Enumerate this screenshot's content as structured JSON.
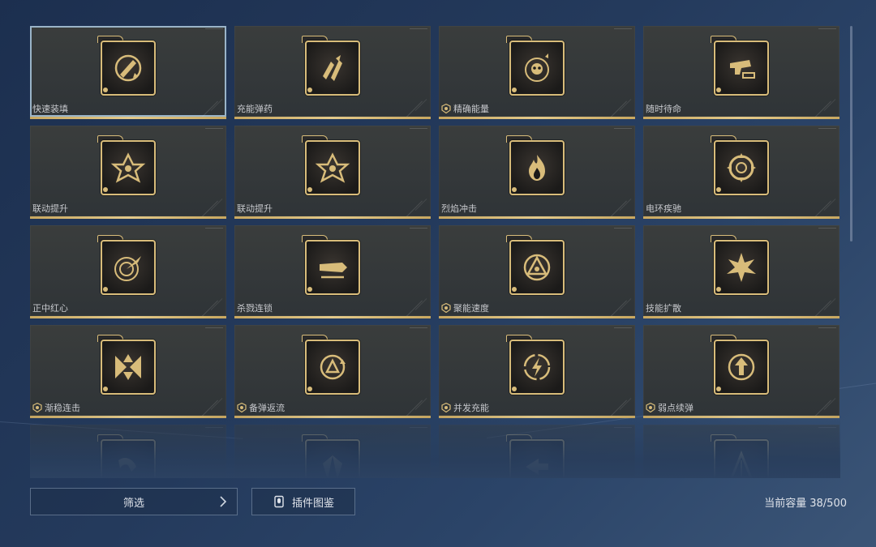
{
  "plugins": [
    {
      "name": "快速装填",
      "icon": "missile-reload-icon",
      "badge": false,
      "selected": true
    },
    {
      "name": "充能弹药",
      "icon": "bullets-icon",
      "badge": false
    },
    {
      "name": "精确能量",
      "icon": "skull-target-icon",
      "badge": true
    },
    {
      "name": "随时待命",
      "icon": "pistol-ammo-icon",
      "badge": false
    },
    {
      "name": "联动提升",
      "icon": "star-link-icon",
      "badge": false
    },
    {
      "name": "联动提升",
      "icon": "star-link-icon",
      "badge": false
    },
    {
      "name": "烈焰冲击",
      "icon": "flame-icon",
      "badge": false
    },
    {
      "name": "电环疾驰",
      "icon": "electric-ring-icon",
      "badge": false
    },
    {
      "name": "正中红心",
      "icon": "bullseye-comet-icon",
      "badge": false
    },
    {
      "name": "杀戮连锁",
      "icon": "blade-chain-icon",
      "badge": false
    },
    {
      "name": "聚能速度",
      "icon": "triangle-core-icon",
      "badge": true
    },
    {
      "name": "技能扩散",
      "icon": "burst-icon",
      "badge": false
    },
    {
      "name": "渐稳连击",
      "icon": "converge-arrows-icon",
      "badge": true
    },
    {
      "name": "备弹返流",
      "icon": "cycle-arrows-icon",
      "badge": true
    },
    {
      "name": "并发充能",
      "icon": "lightning-cycle-icon",
      "badge": true
    },
    {
      "name": "弱点续弹",
      "icon": "up-arrow-target-icon",
      "badge": true
    },
    {
      "name": "",
      "icon": "fish-hook-icon",
      "badge": false
    },
    {
      "name": "",
      "icon": "tribal-wings-icon",
      "badge": false
    },
    {
      "name": "",
      "icon": "split-arrows-icon",
      "badge": false
    },
    {
      "name": "",
      "icon": "triangle-arrows-icon",
      "badge": false
    }
  ],
  "footer": {
    "filter_label": "筛选",
    "codex_label": "插件图鉴",
    "capacity_label": "当前容量",
    "capacity_value": "38/500"
  },
  "colors": {
    "accent_gold": "#d8bc7a",
    "selected_outline": "#9ab4c8",
    "background": "#243a5c"
  }
}
